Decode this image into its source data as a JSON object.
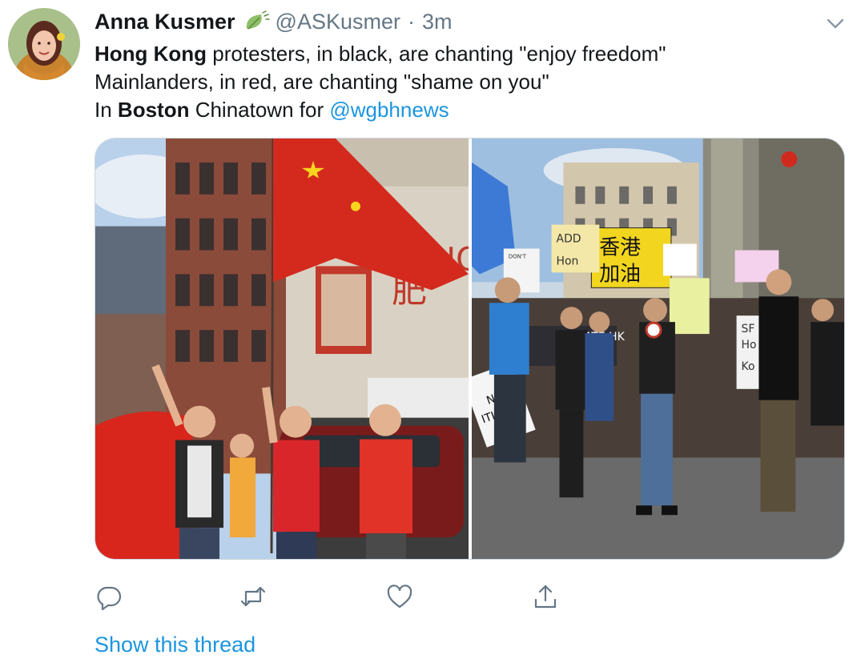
{
  "author": {
    "display_name": "Anna Kusmer",
    "handle": "@ASKusmer",
    "separator": "·",
    "time": "3m",
    "avatar_icon": "avatar",
    "name_badge_icon": "leaf-icon"
  },
  "tweet": {
    "line1": {
      "bold": "Hong Kong",
      "rest": " protesters, in black, are chanting \"enjoy freedom\""
    },
    "line2": "Mainlanders, in red, are chanting \"shame on you\"",
    "line3": {
      "prefix": "In ",
      "bold": "Boston",
      "middle": " Chinatown for ",
      "mention": "@wgbhnews"
    }
  },
  "media": {
    "left_photo": {
      "signs": [
        "肥",
        "HO"
      ]
    },
    "right_photo": {
      "signs": [
        "香港",
        "加油",
        "TIGATE HK",
        "ADD",
        "Hon",
        "DON'T",
        "SF",
        "Ho",
        "Ko",
        "NA",
        "ITION"
      ]
    }
  },
  "actions": {
    "reply_icon": "reply-icon",
    "retweet_icon": "retweet-icon",
    "like_icon": "heart-icon",
    "share_icon": "share-icon"
  },
  "show_thread_label": "Show this thread",
  "colors": {
    "link": "#1b95e0",
    "secondary_text": "#657786",
    "text": "#14171a"
  }
}
